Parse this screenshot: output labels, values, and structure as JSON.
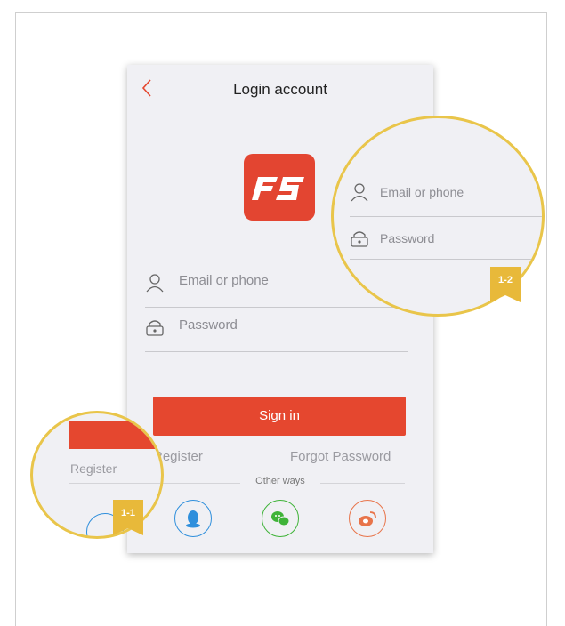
{
  "screen": {
    "title": "Login account",
    "logo_text": "FS",
    "email_placeholder": "Email or phone",
    "password_placeholder": "Password",
    "sign_in_label": "Sign in",
    "register_label": "Register",
    "forgot_password_label": "Forgot Password",
    "other_ways_label": "Other ways",
    "social": [
      {
        "name": "qq-icon",
        "color": "#2f8fdc"
      },
      {
        "name": "wechat-icon",
        "color": "#3fb338"
      },
      {
        "name": "weibo-icon",
        "color": "#e8744a"
      }
    ]
  },
  "callouts": {
    "zoom_right": {
      "badge": "1-2",
      "email_placeholder": "Email or phone",
      "password_placeholder": "Password"
    },
    "zoom_left": {
      "badge": "1-1",
      "register_label": "Register"
    }
  },
  "colors": {
    "accent": "#e5472f",
    "highlight": "#e9c54a"
  }
}
